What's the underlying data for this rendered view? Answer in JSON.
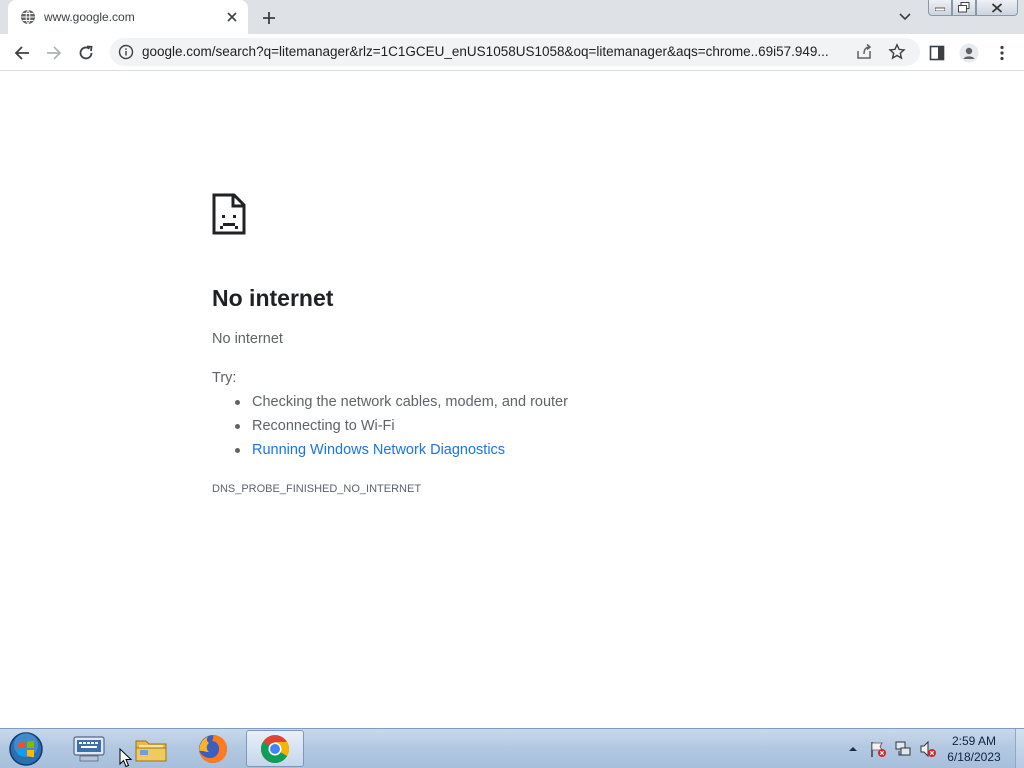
{
  "browser": {
    "tab": {
      "title": "www.google.com"
    },
    "address_bar": {
      "url": "google.com/search?q=litemanager&rlz=1C1GCEU_enUS1058US1058&oq=litemanager&aqs=chrome..69i57.949..."
    }
  },
  "error_page": {
    "heading": "No internet",
    "message": "No internet",
    "try_label": "Try:",
    "suggestions": [
      "Checking the network cables, modem, and router",
      "Reconnecting to Wi-Fi"
    ],
    "diagnostics_link": "Running Windows Network Diagnostics",
    "error_code": "DNS_PROBE_FINISHED_NO_INTERNET"
  },
  "taskbar": {
    "clock": {
      "time": "2:59 AM",
      "date": "6/18/2023"
    }
  },
  "colors": {
    "accent_link": "#1a73e8",
    "text_primary": "#202124",
    "text_secondary": "#5f6368"
  }
}
